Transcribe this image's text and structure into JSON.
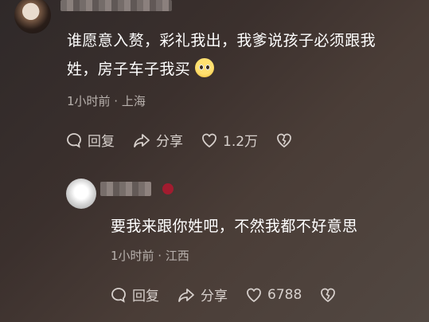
{
  "comment": {
    "text_line1": "谁愿意入赘，彩礼我出，我爹说孩子必须跟我",
    "text_line2": "姓，房子车子我买",
    "meta": "1小时前 · 上海",
    "actions": {
      "reply_label": "回复",
      "share_label": "分享",
      "like_count": "1.2万"
    },
    "icons": {
      "emoji": "pleading-face-emoji"
    }
  },
  "reply": {
    "text": "要我来跟你姓吧，不然我都不好意思",
    "meta": "1小时前 · 江西",
    "actions": {
      "reply_label": "回复",
      "share_label": "分享",
      "like_count": "6788"
    }
  },
  "colors": {
    "text": "#ffffff",
    "meta": "#b8b1ad",
    "action": "#d7d0cc"
  }
}
